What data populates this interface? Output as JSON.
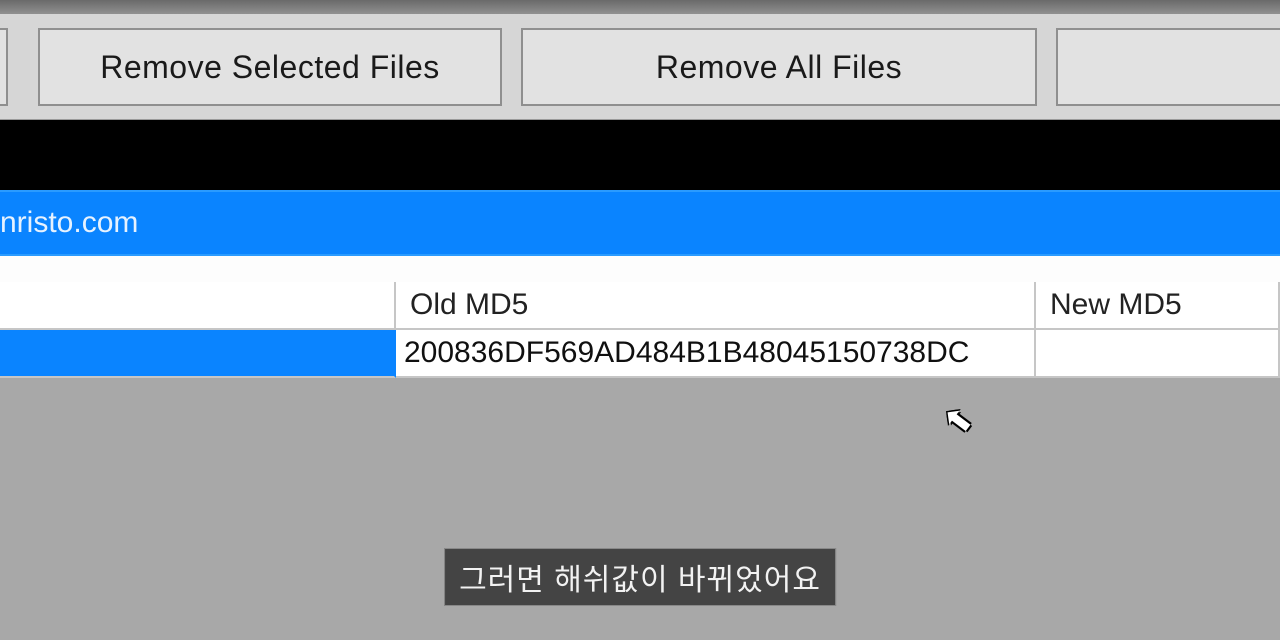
{
  "toolbar": {
    "remove_selected_label": "Remove Selected Files",
    "remove_all_label": "Remove All Files"
  },
  "blue_bar": {
    "text": "nristo.com"
  },
  "table": {
    "headers": {
      "file": "",
      "old_md5": "Old MD5",
      "new_md5": "New MD5"
    },
    "rows": [
      {
        "file": "",
        "old_md5": "200836DF569AD484B1B48045150738DC",
        "new_md5": ""
      }
    ]
  },
  "caption": "그러면 해쉬값이 바뀌었어요",
  "cursor_glyph": "⬉"
}
